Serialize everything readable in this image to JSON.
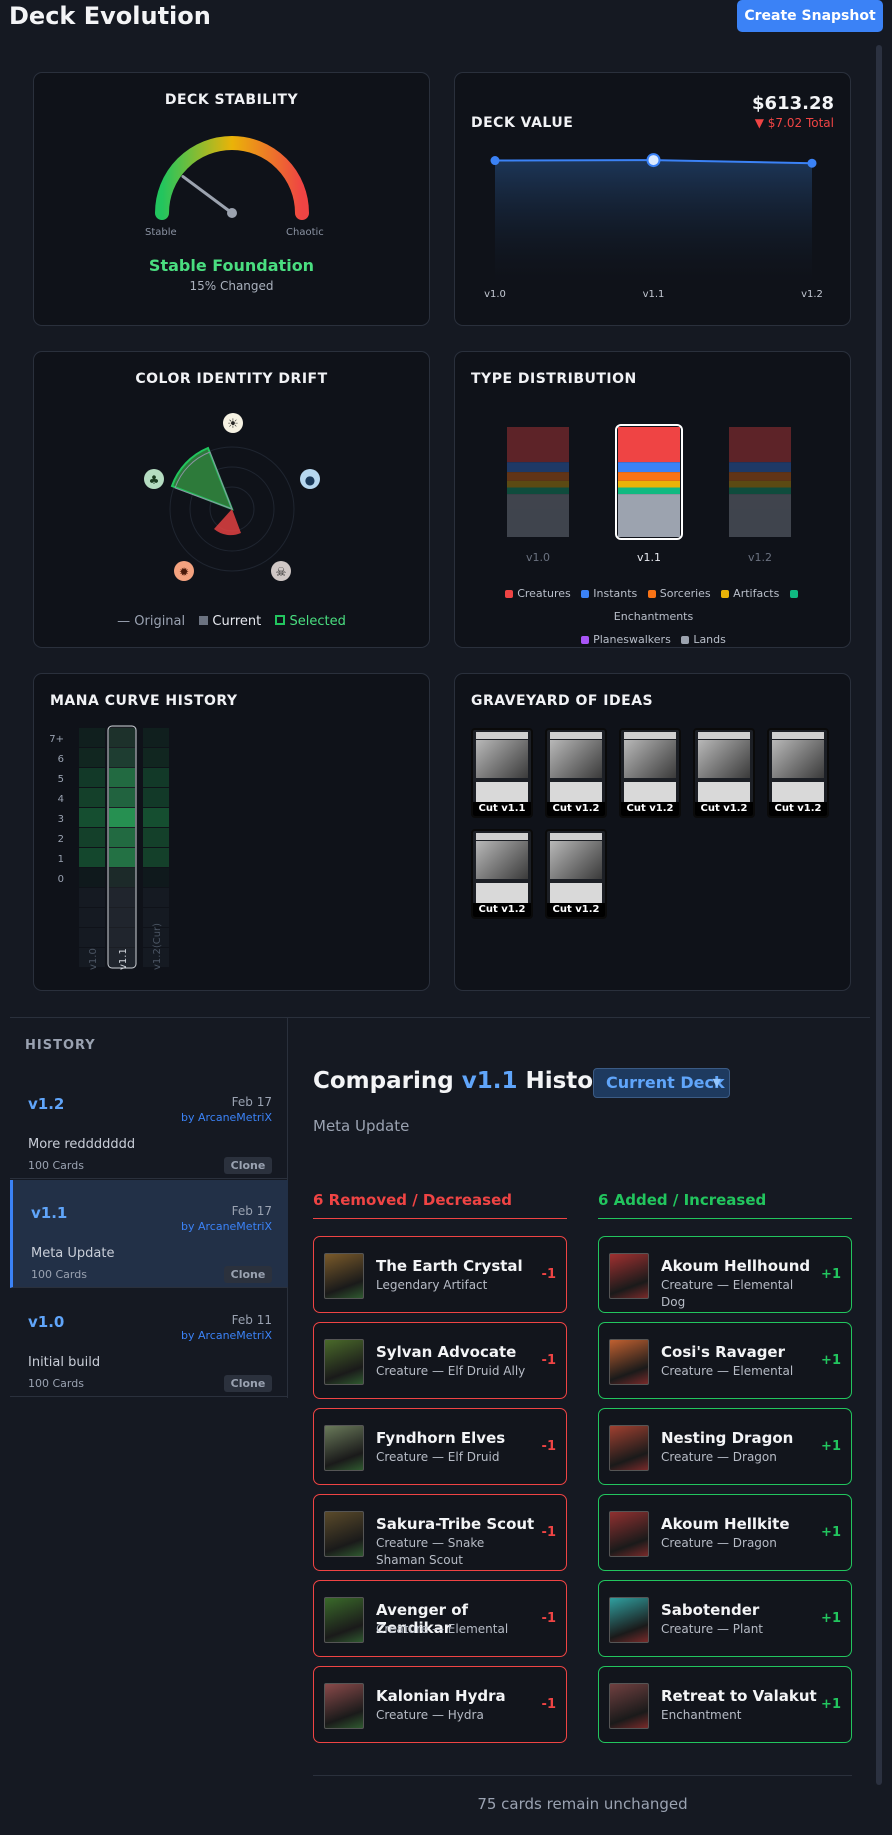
{
  "header": {
    "title": "Deck Evolution",
    "snapshot_label": "Create Snapshot"
  },
  "stability": {
    "title": "DECK STABILITY",
    "left_label": "Stable",
    "right_label": "Chaotic",
    "status": "Stable Foundation",
    "changed": "15% Changed",
    "changed_fraction": 0.15
  },
  "value": {
    "title": "DECK VALUE",
    "amount": "$613.28",
    "delta": "▼ $7.02 Total"
  },
  "value_chart": {
    "type": "line",
    "categories": [
      "v1.0",
      "v1.1",
      "v1.2"
    ],
    "values": [
      620.3,
      621.5,
      613.28
    ],
    "ylim": [
      300,
      640
    ]
  },
  "color_drift": {
    "title": "COLOR IDENTITY DRIFT",
    "legend": {
      "original": "Original",
      "current": "Current",
      "selected": "Selected"
    },
    "colors": {
      "green": "#22c55e",
      "red": "#ef4444"
    }
  },
  "type_dist": {
    "title": "TYPE DISTRIBUTION",
    "versions": [
      "v1.0",
      "v1.1",
      "v1.2"
    ],
    "legend": [
      "Creatures",
      "Instants",
      "Sorceries",
      "Artifacts",
      "Enchantments",
      "Planeswalkers",
      "Lands"
    ],
    "legend_colors": [
      "#ef4444",
      "#3b82f6",
      "#f97316",
      "#eab308",
      "#10b981",
      "#a855f7",
      "#9ca3af"
    ]
  },
  "chart_data": [
    {
      "type": "bar",
      "title": "TYPE DISTRIBUTION",
      "categories": [
        "v1.0",
        "v1.1",
        "v1.2"
      ],
      "series": [
        {
          "name": "Creatures",
          "values": [
            32,
            32,
            32
          ]
        },
        {
          "name": "Instants",
          "values": [
            9,
            9,
            9
          ]
        },
        {
          "name": "Sorceries",
          "values": [
            8,
            8,
            8
          ]
        },
        {
          "name": "Artifacts",
          "values": [
            6,
            6,
            6
          ]
        },
        {
          "name": "Enchantments",
          "values": [
            6,
            6,
            6
          ]
        },
        {
          "name": "Planeswalkers",
          "values": [
            0,
            0,
            0
          ]
        },
        {
          "name": "Lands",
          "values": [
            39,
            39,
            39
          ]
        }
      ]
    },
    {
      "type": "heatmap",
      "title": "MANA CURVE HISTORY",
      "x": [
        "v1.0",
        "v1.1",
        "v1.2"
      ],
      "y": [
        "7+",
        "6",
        "5",
        "4",
        "3",
        "2",
        "1",
        "0"
      ],
      "values": [
        [
          0.1,
          0.15,
          0.1
        ],
        [
          0.15,
          0.25,
          0.15
        ],
        [
          0.3,
          0.6,
          0.3
        ],
        [
          0.35,
          0.55,
          0.3
        ],
        [
          0.45,
          0.9,
          0.45
        ],
        [
          0.35,
          0.6,
          0.35
        ],
        [
          0.4,
          0.65,
          0.35
        ],
        [
          0.05,
          0.1,
          0.05
        ]
      ]
    }
  ],
  "mana_curve": {
    "title": "MANA CURVE HISTORY",
    "rows": [
      "7+",
      "6",
      "5",
      "4",
      "3",
      "2",
      "1",
      "0"
    ],
    "columns": [
      "v1.0",
      "v1.1",
      "v1.2(Cur)"
    ]
  },
  "graveyard": {
    "title": "GRAVEYARD OF IDEAS",
    "cards": [
      "Cut v1.1",
      "Cut v1.2",
      "Cut v1.2",
      "Cut v1.2",
      "Cut v1.2",
      "Cut v1.2",
      "Cut v1.2"
    ]
  },
  "history": {
    "title": "HISTORY",
    "items": [
      {
        "version": "v1.2",
        "date": "Feb 17",
        "author": "by ArcaneMetriX",
        "message": "More reddddddd",
        "cards": "100 Cards",
        "clone": "Clone"
      },
      {
        "version": "v1.1",
        "date": "Feb 17",
        "author": "by ArcaneMetriX",
        "message": "Meta Update",
        "cards": "100 Cards",
        "clone": "Clone"
      },
      {
        "version": "v1.0",
        "date": "Feb 11",
        "author": "by ArcaneMetriX",
        "message": "Initial build",
        "cards": "100 Cards",
        "clone": "Clone"
      }
    ]
  },
  "compare": {
    "prefix": "Comparing",
    "version": "v1.1",
    "suffix": "History",
    "target": "Current Deck",
    "subtitle": "Meta Update",
    "removed_title": "6 Removed / Decreased",
    "added_title": "6 Added / Increased",
    "removed": [
      {
        "name": "The Earth Crystal",
        "type": "Legendary Artifact",
        "delta": "-1"
      },
      {
        "name": "Sylvan Advocate",
        "type": "Creature — Elf Druid Ally",
        "delta": "-1"
      },
      {
        "name": "Fyndhorn Elves",
        "type": "Creature — Elf Druid",
        "delta": "-1"
      },
      {
        "name": "Sakura-Tribe Scout",
        "type": "Creature — Snake Shaman Scout",
        "delta": "-1"
      },
      {
        "name": "Avenger of Zendikar",
        "type": "Creature — Elemental",
        "delta": "-1"
      },
      {
        "name": "Kalonian Hydra",
        "type": "Creature — Hydra",
        "delta": "-1"
      }
    ],
    "added": [
      {
        "name": "Akoum Hellhound",
        "type": "Creature — Elemental Dog",
        "delta": "+1"
      },
      {
        "name": "Cosi's Ravager",
        "type": "Creature — Elemental",
        "delta": "+1"
      },
      {
        "name": "Nesting Dragon",
        "type": "Creature — Dragon",
        "delta": "+1"
      },
      {
        "name": "Akoum Hellkite",
        "type": "Creature — Dragon",
        "delta": "+1"
      },
      {
        "name": "Sabotender",
        "type": "Creature — Plant",
        "delta": "+1"
      },
      {
        "name": "Retreat to Valakut",
        "type": "Enchantment",
        "delta": "+1"
      }
    ],
    "unchanged": "75 cards remain unchanged"
  }
}
